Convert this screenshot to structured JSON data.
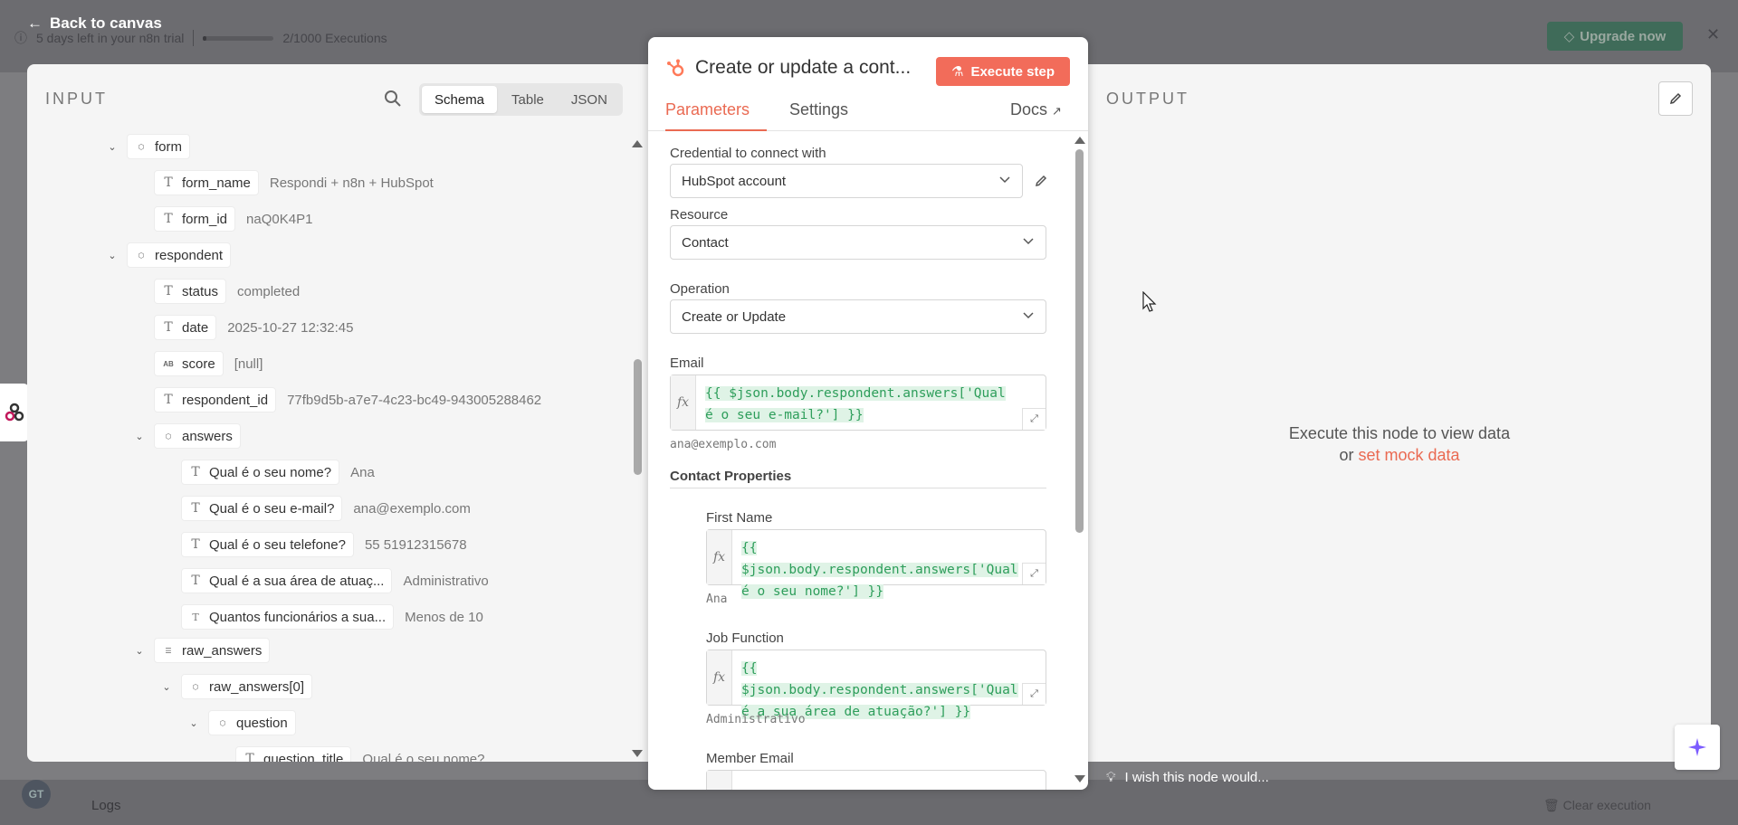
{
  "background": {
    "trial_text": "5 days left in your n8n trial",
    "executions_text": "2/1000 Executions",
    "upgrade_label": "Upgrade now",
    "back_label": "Back to canvas",
    "logs_label": "Logs",
    "clear_label": "Clear execution",
    "avatar_initials": "GT"
  },
  "input": {
    "title": "INPUT",
    "views": [
      "Schema",
      "Table",
      "JSON"
    ],
    "active_view": "Schema",
    "schema": {
      "form": "form",
      "form_name_key": "form_name",
      "form_name_val": "Respondi + n8n + HubSpot",
      "form_id_key": "form_id",
      "form_id_val": "naQ0K4P1",
      "respondent": "respondent",
      "status_key": "status",
      "status_val": "completed",
      "date_key": "date",
      "date_val": "2025-10-27 12:32:45",
      "score_key": "score",
      "score_val": "[null]",
      "respondent_id_key": "respondent_id",
      "respondent_id_val": "77fb9d5b-a7e7-4c23-bc49-943005288462",
      "answers": "answers",
      "q_nome_key": "Qual é o seu nome?",
      "q_nome_val": "Ana",
      "q_email_key": "Qual é o seu e-mail?",
      "q_email_val": "ana@exemplo.com",
      "q_tel_key": "Qual é o seu telefone?",
      "q_tel_val": "55 51912315678",
      "q_area_key": "Qual é a sua área de atuaç...",
      "q_area_val": "Administrativo",
      "q_func_key": "Quantos funcionários a sua...",
      "q_func_val": "Menos de 10",
      "raw_answers": "raw_answers",
      "raw_answers_0": "raw_answers[0]",
      "question": "question",
      "question_title_key": "question_title",
      "question_title_val": "Qual é o seu nome?"
    }
  },
  "node": {
    "title": "Create or update a cont...",
    "execute_label": "Execute step",
    "tabs": [
      "Parameters",
      "Settings"
    ],
    "docs_label": "Docs",
    "credential_label": "Credential to connect with",
    "credential_value": "HubSpot account",
    "resource_label": "Resource",
    "resource_value": "Contact",
    "operation_label": "Operation",
    "operation_value": "Create or Update",
    "email_label": "Email",
    "email_expr": "{{ $json.body.respondent.answers['Qual é o seu e-mail?'] }}",
    "email_hint": "ana@exemplo.com",
    "contact_props_label": "Contact Properties",
    "first_name_label": "First Name",
    "first_name_expr": "{{ $json.body.respondent.answers['Qual é o seu nome?'] }}",
    "first_name_hint": "Ana",
    "job_function_label": "Job Function",
    "job_function_expr": "{{ $json.body.respondent.answers['Qual é a sua área de atuação?'] }}",
    "job_function_hint": "Administrativo",
    "member_email_label": "Member Email"
  },
  "output": {
    "title": "OUTPUT",
    "message": "Execute this node to view data",
    "or_text": "or",
    "mock_link": "set mock data",
    "wish_text": "I wish this node would..."
  },
  "colors": {
    "accent": "#ea6a52",
    "expr_green": "#2e9e5b",
    "upgrade": "#3f6b59"
  }
}
